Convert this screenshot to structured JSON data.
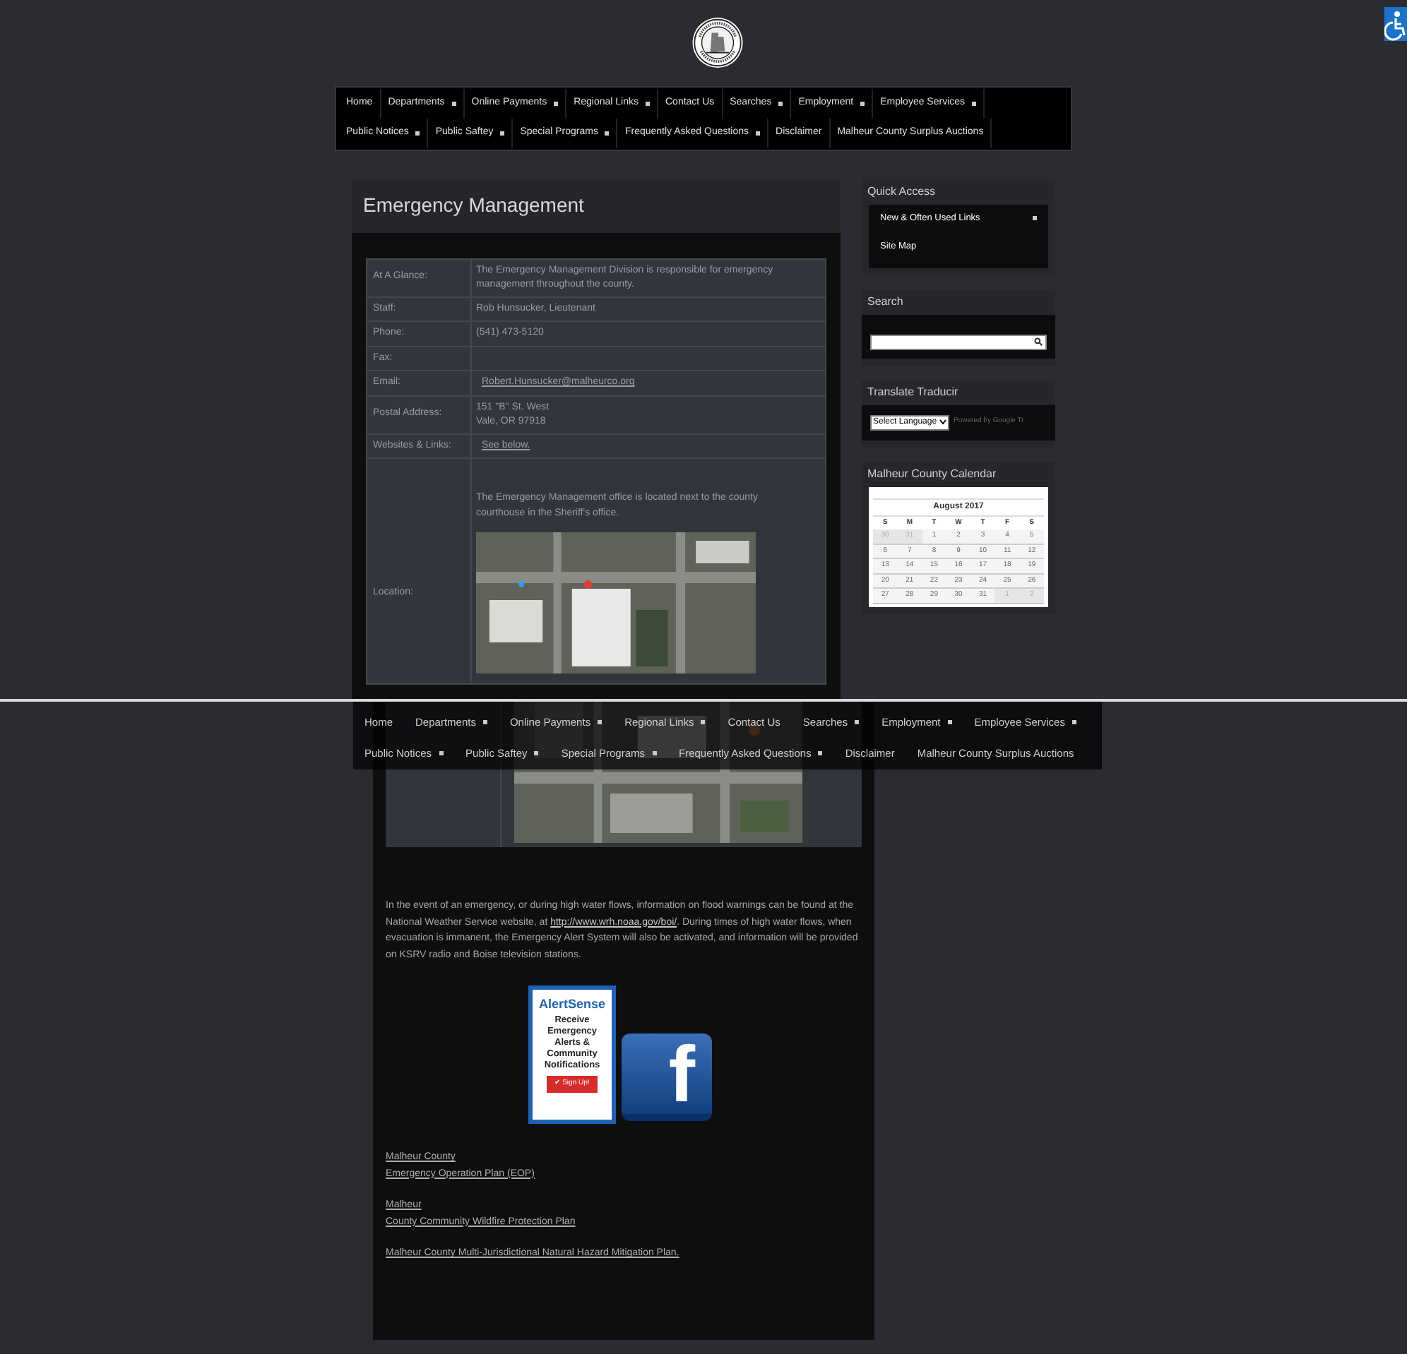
{
  "nav": [
    {
      "label": "Home",
      "has_menu": false
    },
    {
      "label": "Departments",
      "has_menu": true
    },
    {
      "label": "Online Payments",
      "has_menu": true
    },
    {
      "label": "Regional Links",
      "has_menu": true
    },
    {
      "label": "Contact Us",
      "has_menu": false
    },
    {
      "label": "Searches",
      "has_menu": true
    },
    {
      "label": "Employment",
      "has_menu": true
    },
    {
      "label": "Employee Services",
      "has_menu": true
    },
    {
      "label": "Public Notices",
      "has_menu": true
    },
    {
      "label": "Public Saftey",
      "has_menu": true
    },
    {
      "label": "Special Programs",
      "has_menu": true
    },
    {
      "label": "Frequently Asked Questions",
      "has_menu": true
    },
    {
      "label": "Disclaimer",
      "has_menu": false
    },
    {
      "label": "Malheur County Surplus Auctions",
      "has_menu": false
    }
  ],
  "page_title": "Emergency Management",
  "info_rows": [
    {
      "label": "At A Glance:",
      "value": "The Emergency Management Division is responsible for emergency management throughout the county.",
      "kind": "text"
    },
    {
      "label": "Staff:",
      "value": "Rob Hunsucker, Lieutenant",
      "kind": "text"
    },
    {
      "label": "Phone:",
      "value": "(541) 473-5120",
      "kind": "text"
    },
    {
      "label": "Fax:",
      "value": "",
      "kind": "empty"
    },
    {
      "label": "Email:",
      "value": "Robert.Hunsucker@malheurco.org",
      "kind": "link"
    },
    {
      "label": "Postal Address:",
      "value": "151 \"B\" St. West\nVale, OR 97918",
      "kind": "text"
    },
    {
      "label": "Websites & Links:",
      "value": "See below.",
      "kind": "link"
    }
  ],
  "location": {
    "label": "Location:",
    "text": "The Emergency Management office is located next to the county courthouse in the Sheriff's office."
  },
  "sidebar": {
    "quick_access": {
      "title": "Quick Access",
      "items": [
        {
          "label": "New & Often Used Links",
          "has_menu": true
        },
        {
          "label": "Site Map",
          "has_menu": false
        }
      ]
    },
    "search": {
      "title": "Search"
    },
    "translate": {
      "title": "Translate Traducir",
      "select": "Select Language",
      "powered_by": "Powered by Google Tr"
    },
    "calendar": {
      "title": "Malheur County Calendar",
      "month": "August 2017",
      "weekdays": [
        "S",
        "M",
        "T",
        "W",
        "T",
        "F",
        "S"
      ],
      "weeks": [
        [
          {
            "day": "30",
            "other_month": true
          },
          {
            "day": "31",
            "other_month": true
          },
          {
            "day": "1",
            "other_month": false
          },
          {
            "day": "2",
            "other_month": false
          },
          {
            "day": "3",
            "other_month": false
          },
          {
            "day": "4",
            "other_month": false
          },
          {
            "day": "5",
            "other_month": false
          }
        ],
        [
          {
            "day": "6",
            "other_month": false
          },
          {
            "day": "7",
            "other_month": false
          },
          {
            "day": "8",
            "other_month": false
          },
          {
            "day": "9",
            "other_month": false
          },
          {
            "day": "10",
            "other_month": false
          },
          {
            "day": "11",
            "other_month": false
          },
          {
            "day": "12",
            "other_month": false
          }
        ],
        [
          {
            "day": "13",
            "other_month": false
          },
          {
            "day": "14",
            "other_month": false
          },
          {
            "day": "15",
            "other_month": false
          },
          {
            "day": "16",
            "other_month": false
          },
          {
            "day": "17",
            "other_month": false
          },
          {
            "day": "18",
            "other_month": false
          },
          {
            "day": "19",
            "other_month": false
          }
        ],
        [
          {
            "day": "20",
            "other_month": false
          },
          {
            "day": "21",
            "other_month": false
          },
          {
            "day": "22",
            "other_month": false
          },
          {
            "day": "23",
            "other_month": false
          },
          {
            "day": "24",
            "other_month": false
          },
          {
            "day": "25",
            "other_month": false
          },
          {
            "day": "26",
            "other_month": false
          }
        ],
        [
          {
            "day": "27",
            "other_month": false
          },
          {
            "day": "28",
            "other_month": false
          },
          {
            "day": "29",
            "other_month": false
          },
          {
            "day": "30",
            "other_month": false
          },
          {
            "day": "31",
            "other_month": false
          },
          {
            "day": "1",
            "other_month": true
          },
          {
            "day": "2",
            "other_month": true
          }
        ]
      ]
    }
  },
  "lower_nav": [
    {
      "label": "Home",
      "has_menu": false
    },
    {
      "label": "Departments",
      "has_menu": true
    },
    {
      "label": "Online Payments",
      "has_menu": true
    },
    {
      "label": "Regional Links",
      "has_menu": true
    },
    {
      "label": "Contact Us",
      "has_menu": false
    },
    {
      "label": "Searches",
      "has_menu": true
    },
    {
      "label": "Employment",
      "has_menu": true
    },
    {
      "label": "Employee Services",
      "has_menu": true
    },
    {
      "label": "Public Notices",
      "has_menu": true
    },
    {
      "label": "Public Saftey",
      "has_menu": true
    },
    {
      "label": "Special Programs",
      "has_menu": true
    },
    {
      "label": "Frequently Asked Questions",
      "has_menu": true
    },
    {
      "label": "Disclaimer",
      "has_menu": false
    },
    {
      "label": "Malheur County Surplus Auctions",
      "has_menu": false
    }
  ],
  "emergency_text": {
    "before": "In the event of an emergency, or during high water flows, information on flood warnings can be found at the National Weather Service website, at ",
    "link": "http://www.wrh.noaa.gov/boi/",
    "after": ". During times of high water flows, when evacuation is immanent,  the Emergency Alert System will also be activated, and information will be provided on KSRV radio and Boise television stations."
  },
  "alert_badge": {
    "brand": "AlertSense",
    "text": "Receive Emergency Alerts & Community Notifications",
    "button": "✔ Sign Up!"
  },
  "social_badge": {
    "letter": "f"
  },
  "documents": [
    [
      "Malheur County",
      "Emergency Operation Plan (EOP)"
    ],
    [
      "Malheur",
      "County Community Wildfire Protection Plan"
    ],
    [
      "Malheur County Multi-Jurisdictional Natural Hazard Mitigation Plan."
    ]
  ]
}
